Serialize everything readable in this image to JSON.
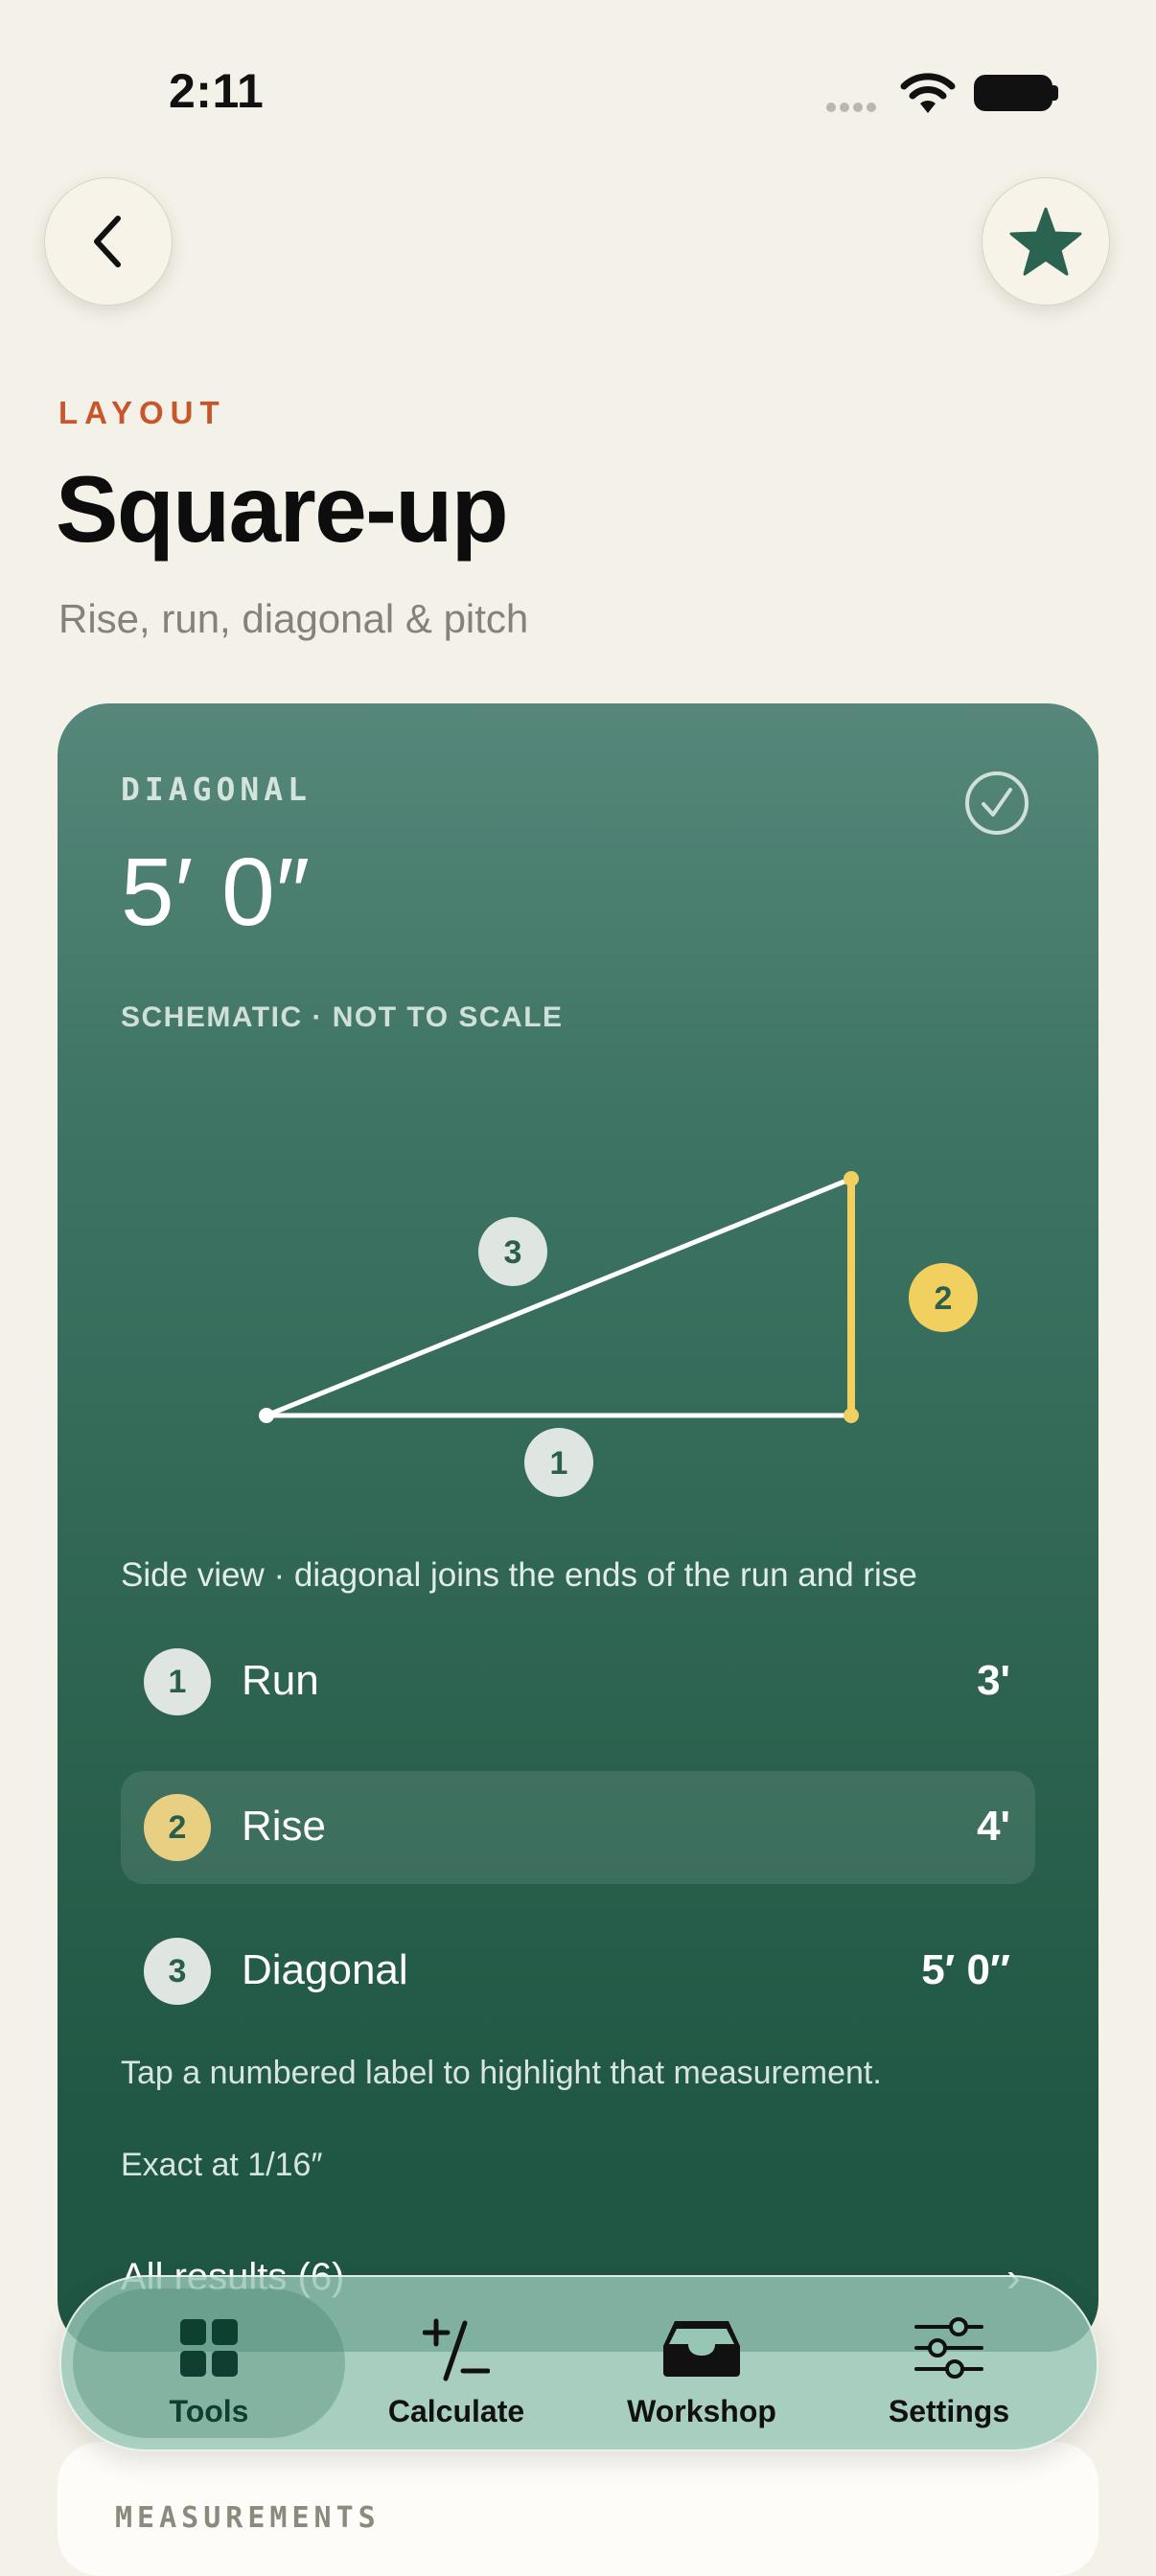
{
  "status_bar": {
    "time": "2:11"
  },
  "header": {
    "eyebrow": "LAYOUT",
    "title": "Square-up",
    "subtitle": "Rise, run, diagonal & pitch"
  },
  "result_card": {
    "label": "DIAGONAL",
    "value": "5′ 0″",
    "schematic_note": "SCHEMATIC · NOT TO SCALE",
    "diagram_badges": {
      "run": "1",
      "rise": "2",
      "diagonal": "3"
    },
    "caption": "Side view · diagonal joins the ends of the run and rise",
    "rows": [
      {
        "number": "1",
        "label": "Run",
        "value": "3'"
      },
      {
        "number": "2",
        "label": "Rise",
        "value": "4'"
      },
      {
        "number": "3",
        "label": "Diagonal",
        "value": "5′ 0″"
      }
    ],
    "hint": "Tap a numbered label to highlight that measurement.",
    "precision": "Exact at 1/16″",
    "all_results": "All results (6)"
  },
  "tabs": [
    {
      "label": "Tools",
      "icon": "grid-icon",
      "active": true
    },
    {
      "label": "Calculate",
      "icon": "plus-minus-icon",
      "active": false
    },
    {
      "label": "Workshop",
      "icon": "tray-icon",
      "active": false
    },
    {
      "label": "Settings",
      "icon": "sliders-icon",
      "active": false
    }
  ],
  "measurements_section": {
    "label": "MEASUREMENTS"
  },
  "colors": {
    "accent_orange": "#c8562d",
    "card_green": "#2f6552",
    "highlight_yellow": "#f2d060"
  }
}
